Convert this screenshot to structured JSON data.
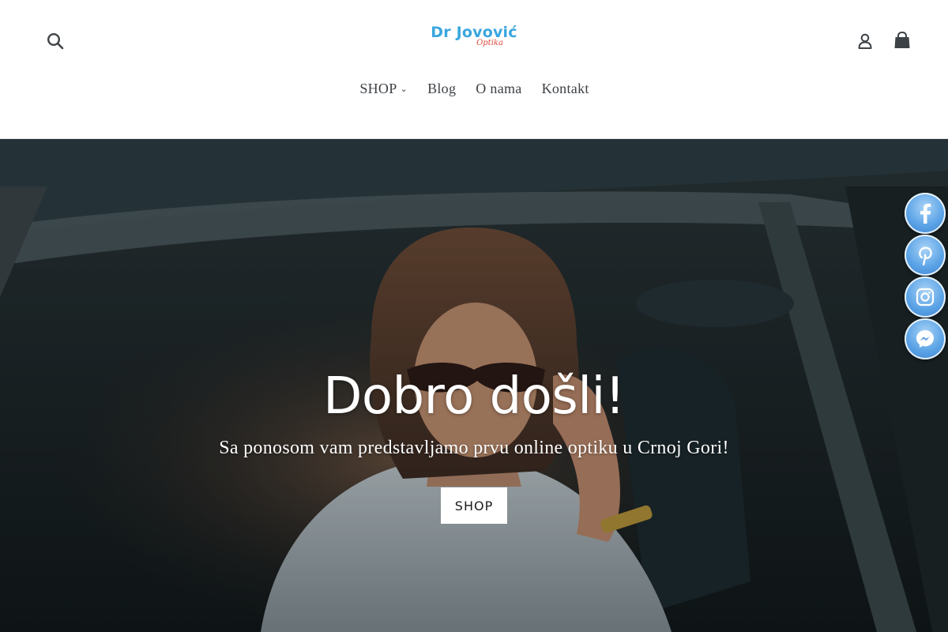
{
  "header": {
    "logo": {
      "main": "Dr Jovović",
      "sub": "Optika"
    },
    "icons": {
      "search": "search-icon",
      "account": "user-icon",
      "cart": "cart-icon"
    },
    "nav": [
      {
        "label": "SHOP",
        "has_dropdown": true
      },
      {
        "label": "Blog"
      },
      {
        "label": "O nama"
      },
      {
        "label": "Kontakt"
      }
    ]
  },
  "hero": {
    "title": "Dobro došli!",
    "subtitle": "Sa ponosom vam predstavljamo prvu online optiku u Crnoj Gori!",
    "button_label": "SHOP"
  },
  "social": [
    {
      "name": "facebook",
      "icon": "facebook-icon"
    },
    {
      "name": "pinterest",
      "icon": "pinterest-icon"
    },
    {
      "name": "instagram",
      "icon": "instagram-icon"
    },
    {
      "name": "messenger",
      "icon": "messenger-icon"
    }
  ],
  "colors": {
    "logo_blue": "#3aa6df",
    "logo_red": "#e0483c",
    "text_dark": "#3d4246",
    "hero_text": "#ffffff",
    "social_blue": "#5ba3e6"
  }
}
